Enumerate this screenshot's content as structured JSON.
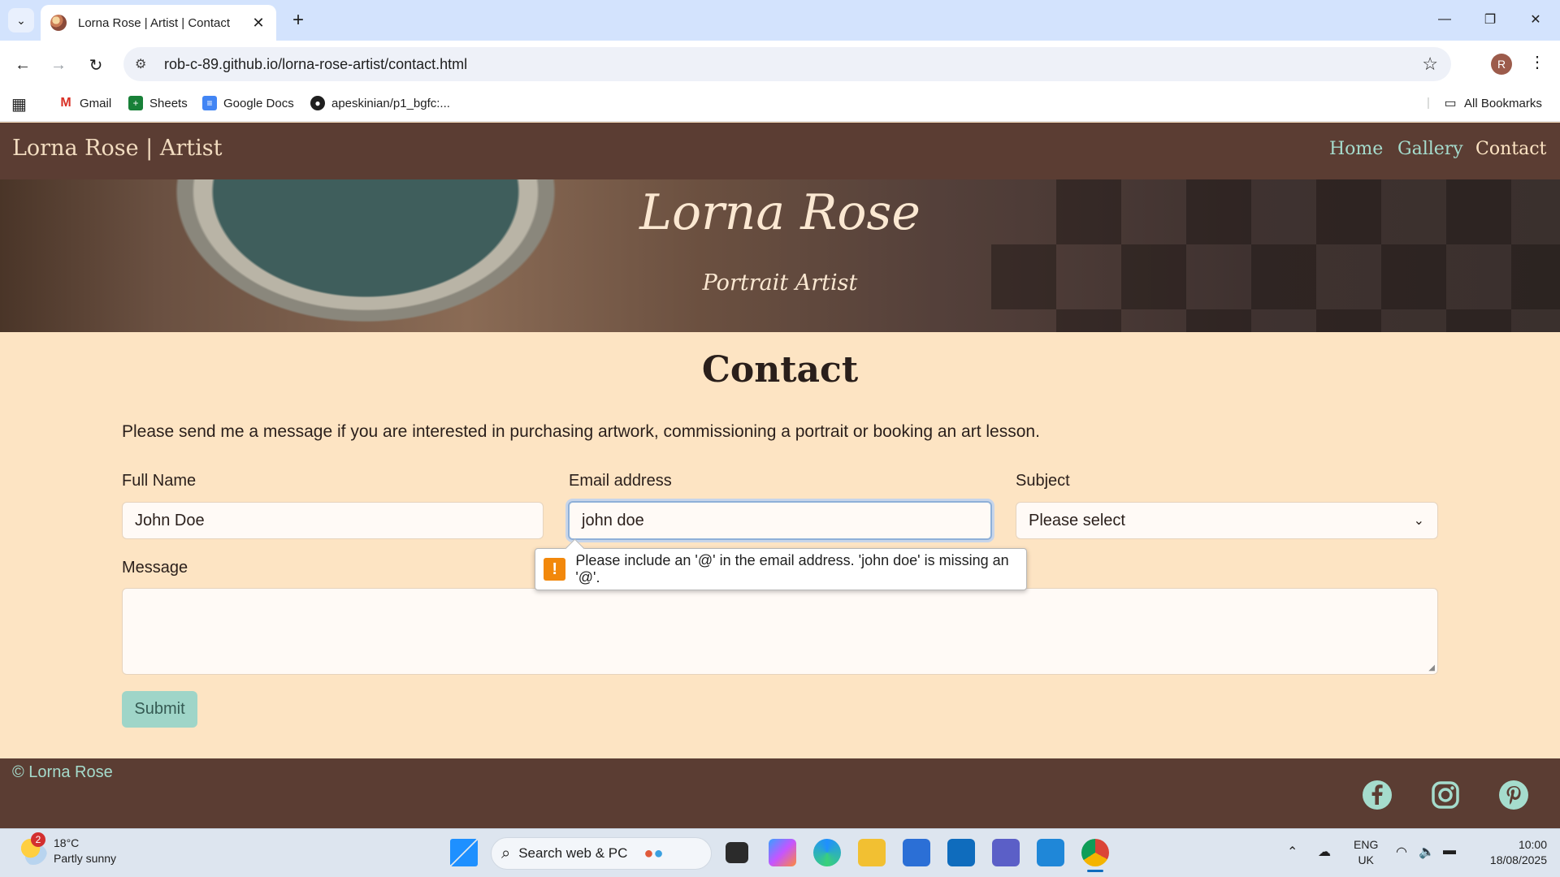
{
  "browser": {
    "tab_title": "Lorna Rose | Artist | Contact",
    "url": "rob-c-89.github.io/lorna-rose-artist/contact.html",
    "profile_initial": "R",
    "bookmarks": [
      "Gmail",
      "Sheets",
      "Google Docs",
      "apeskinian/p1_bgfc:..."
    ],
    "all_bookmarks": "All Bookmarks"
  },
  "site": {
    "brand": "Lorna Rose | Artist",
    "nav": [
      "Home",
      "Gallery",
      "Contact"
    ],
    "active_nav": "Contact",
    "hero_title": "Lorna Rose",
    "hero_subtitle": "Portrait Artist"
  },
  "contact": {
    "heading": "Contact",
    "intro": "Please send me a message if you are interested in purchasing artwork, commissioning a portrait or booking an art lesson.",
    "full_name_label": "Full Name",
    "full_name_value": "John Doe",
    "email_label": "Email address",
    "email_value": "john doe",
    "subject_label": "Subject",
    "subject_value": "Please select",
    "message_label": "Message",
    "submit_label": "Submit",
    "validation_message": "Please include an '@' in the email address. 'john doe' is missing an '@'."
  },
  "footer": {
    "copyright": "© Lorna Rose",
    "social_icons": [
      "facebook-icon",
      "instagram-icon",
      "pinterest-icon"
    ]
  },
  "taskbar": {
    "weather_badge": "2",
    "temperature": "18°C",
    "weather_desc": "Partly sunny",
    "search_placeholder": "Search web & PC",
    "lang_line1": "ENG",
    "lang_line2": "UK",
    "time": "10:00",
    "date": "18/08/2025"
  },
  "colors": {
    "nav_bg": "#5b3d33",
    "page_bg": "#fde4c3",
    "accent": "#a5dccd",
    "submit_bg": "#9fd5c8"
  }
}
